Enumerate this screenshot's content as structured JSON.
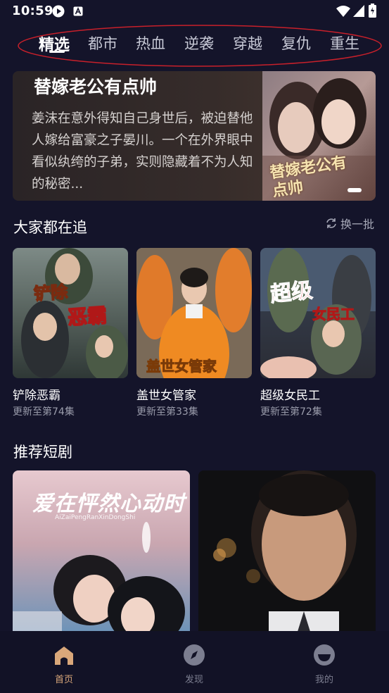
{
  "status_bar": {
    "time": "10:59",
    "icons": [
      "notification-icon",
      "a-badge-icon",
      "wifi-icon",
      "signal-icon",
      "battery-icon"
    ]
  },
  "tabs": [
    "精选",
    "都市",
    "热血",
    "逆袭",
    "穿越",
    "复仇",
    "重生"
  ],
  "active_tab": "精选",
  "banner": {
    "title": "替嫁老公有点帅",
    "description": "姜沫在意外得知自己身世后，被迫替他人嫁给富豪之子晏川。一个在外界眼中看似纨绔的子弟，实则隐藏着不为人知的秘密...",
    "poster_text": "替嫁老公有点帅"
  },
  "popular": {
    "title": "大家都在追",
    "refresh_label": "换一批",
    "items": [
      {
        "title": "铲除恶霸",
        "subtitle": "更新至第74集",
        "poster_text_1": "铲除",
        "poster_text_2": "恶霸"
      },
      {
        "title": "盖世女管家",
        "subtitle": "更新至第33集",
        "poster_text_1": "盖世女管家"
      },
      {
        "title": "超级女民工",
        "subtitle": "更新至第72集",
        "poster_text_1": "超级",
        "poster_text_2": "女民工"
      }
    ]
  },
  "recommend": {
    "title": "推荐短剧",
    "items": [
      {
        "poster_text": "爱在怦然心动时",
        "poster_subtext": "AiZaiPengRanXinDongShi"
      },
      {
        "poster_text": ""
      }
    ]
  },
  "bottom_nav": [
    {
      "label": "首页",
      "icon": "home-icon",
      "active": true
    },
    {
      "label": "发现",
      "icon": "compass-icon",
      "active": false
    },
    {
      "label": "我的",
      "icon": "profile-icon",
      "active": false
    }
  ],
  "colors": {
    "background": "#14142a",
    "nav_active": "#d9a77a",
    "annotation": "#c8202a"
  }
}
